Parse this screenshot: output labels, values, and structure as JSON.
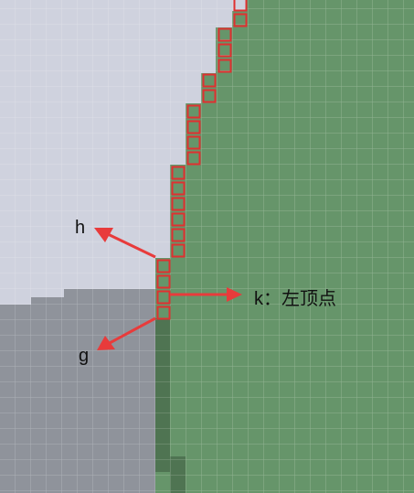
{
  "labels": {
    "h": "h",
    "k": "k：左顶点",
    "g": "g"
  },
  "colors": {
    "light_region": "#cfd2de",
    "green_region": "#66956a",
    "gray_region": "#8f939b",
    "dark_band": "#4f7452",
    "grid_line": "#ffffff",
    "marker_stroke": "#e03030",
    "arrow": "#e83b3b"
  }
}
